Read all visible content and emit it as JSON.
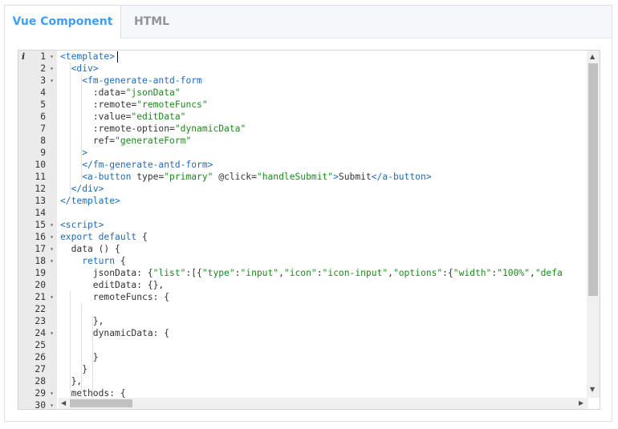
{
  "tabs": [
    {
      "label": "Vue Component",
      "active": true
    },
    {
      "label": "HTML",
      "active": false
    }
  ],
  "editor": {
    "info_marker": "i",
    "lines": [
      {
        "n": "1",
        "fold": true,
        "seg": [
          [
            "tag",
            "<template>"
          ]
        ]
      },
      {
        "n": "2",
        "fold": true,
        "seg": [
          [
            "txt",
            "  "
          ],
          [
            "tag",
            "<div>"
          ]
        ]
      },
      {
        "n": "3",
        "fold": true,
        "seg": [
          [
            "txt",
            "    "
          ],
          [
            "tag",
            "<fm-generate-antd-form"
          ]
        ]
      },
      {
        "n": "4",
        "fold": false,
        "seg": [
          [
            "txt",
            "      "
          ],
          [
            "attr",
            ":data="
          ],
          [
            "str",
            "\"jsonData\""
          ]
        ]
      },
      {
        "n": "5",
        "fold": false,
        "seg": [
          [
            "txt",
            "      "
          ],
          [
            "attr",
            ":remote="
          ],
          [
            "str",
            "\"remoteFuncs\""
          ]
        ]
      },
      {
        "n": "6",
        "fold": false,
        "seg": [
          [
            "txt",
            "      "
          ],
          [
            "attr",
            ":value="
          ],
          [
            "str",
            "\"editData\""
          ]
        ]
      },
      {
        "n": "7",
        "fold": false,
        "seg": [
          [
            "txt",
            "      "
          ],
          [
            "attr",
            ":remote-option="
          ],
          [
            "str",
            "\"dynamicData\""
          ]
        ]
      },
      {
        "n": "8",
        "fold": false,
        "seg": [
          [
            "txt",
            "      "
          ],
          [
            "attr",
            "ref="
          ],
          [
            "str",
            "\"generateForm\""
          ]
        ]
      },
      {
        "n": "9",
        "fold": false,
        "seg": [
          [
            "txt",
            "    "
          ],
          [
            "tag",
            ">"
          ]
        ]
      },
      {
        "n": "10",
        "fold": false,
        "seg": [
          [
            "txt",
            "    "
          ],
          [
            "tag",
            "</fm-generate-antd-form>"
          ]
        ]
      },
      {
        "n": "11",
        "fold": false,
        "seg": [
          [
            "txt",
            "    "
          ],
          [
            "tag",
            "<a-button"
          ],
          [
            "attr",
            " type="
          ],
          [
            "str",
            "\"primary\""
          ],
          [
            "attr",
            " @click="
          ],
          [
            "str",
            "\"handleSubmit\""
          ],
          [
            "tag",
            ">"
          ],
          [
            "txt",
            "Submit"
          ],
          [
            "tag",
            "</a-button>"
          ]
        ]
      },
      {
        "n": "12",
        "fold": false,
        "seg": [
          [
            "txt",
            "  "
          ],
          [
            "tag",
            "</div>"
          ]
        ]
      },
      {
        "n": "13",
        "fold": false,
        "seg": [
          [
            "tag",
            "</template>"
          ]
        ]
      },
      {
        "n": "14",
        "fold": false,
        "seg": [
          [
            "txt",
            ""
          ]
        ]
      },
      {
        "n": "15",
        "fold": true,
        "seg": [
          [
            "tag",
            "<script>"
          ]
        ]
      },
      {
        "n": "16",
        "fold": true,
        "seg": [
          [
            "kw",
            "export default"
          ],
          [
            "txt",
            " {"
          ]
        ]
      },
      {
        "n": "17",
        "fold": true,
        "seg": [
          [
            "txt",
            "  data () {"
          ]
        ]
      },
      {
        "n": "18",
        "fold": true,
        "seg": [
          [
            "txt",
            "    "
          ],
          [
            "kw",
            "return"
          ],
          [
            "txt",
            " {"
          ]
        ]
      },
      {
        "n": "19",
        "fold": false,
        "seg": [
          [
            "txt",
            "      jsonData: {"
          ],
          [
            "str",
            "\"list\""
          ],
          [
            "txt",
            ":[{"
          ],
          [
            "str",
            "\"type\""
          ],
          [
            "txt",
            ":"
          ],
          [
            "str",
            "\"input\""
          ],
          [
            "txt",
            ","
          ],
          [
            "str",
            "\"icon\""
          ],
          [
            "txt",
            ":"
          ],
          [
            "str",
            "\"icon-input\""
          ],
          [
            "txt",
            ","
          ],
          [
            "str",
            "\"options\""
          ],
          [
            "txt",
            ":{"
          ],
          [
            "str",
            "\"width\""
          ],
          [
            "txt",
            ":"
          ],
          [
            "str",
            "\"100%\""
          ],
          [
            "txt",
            ","
          ],
          [
            "str",
            "\"defa"
          ]
        ]
      },
      {
        "n": "20",
        "fold": false,
        "seg": [
          [
            "txt",
            "      editData: {},"
          ]
        ]
      },
      {
        "n": "21",
        "fold": true,
        "seg": [
          [
            "txt",
            "      remoteFuncs: {"
          ]
        ]
      },
      {
        "n": "22",
        "fold": false,
        "seg": [
          [
            "txt",
            ""
          ]
        ]
      },
      {
        "n": "23",
        "fold": false,
        "seg": [
          [
            "txt",
            "      },"
          ]
        ]
      },
      {
        "n": "24",
        "fold": true,
        "seg": [
          [
            "txt",
            "      dynamicData: {"
          ]
        ]
      },
      {
        "n": "25",
        "fold": false,
        "seg": [
          [
            "txt",
            ""
          ]
        ]
      },
      {
        "n": "26",
        "fold": false,
        "seg": [
          [
            "txt",
            "      }"
          ]
        ]
      },
      {
        "n": "27",
        "fold": false,
        "seg": [
          [
            "txt",
            "    }"
          ]
        ]
      },
      {
        "n": "28",
        "fold": false,
        "seg": [
          [
            "txt",
            "  },"
          ]
        ]
      },
      {
        "n": "29",
        "fold": true,
        "seg": [
          [
            "txt",
            "  methods: {"
          ]
        ]
      },
      {
        "n": "30",
        "fold": true,
        "seg": [
          [
            "txt",
            ""
          ]
        ]
      }
    ]
  }
}
